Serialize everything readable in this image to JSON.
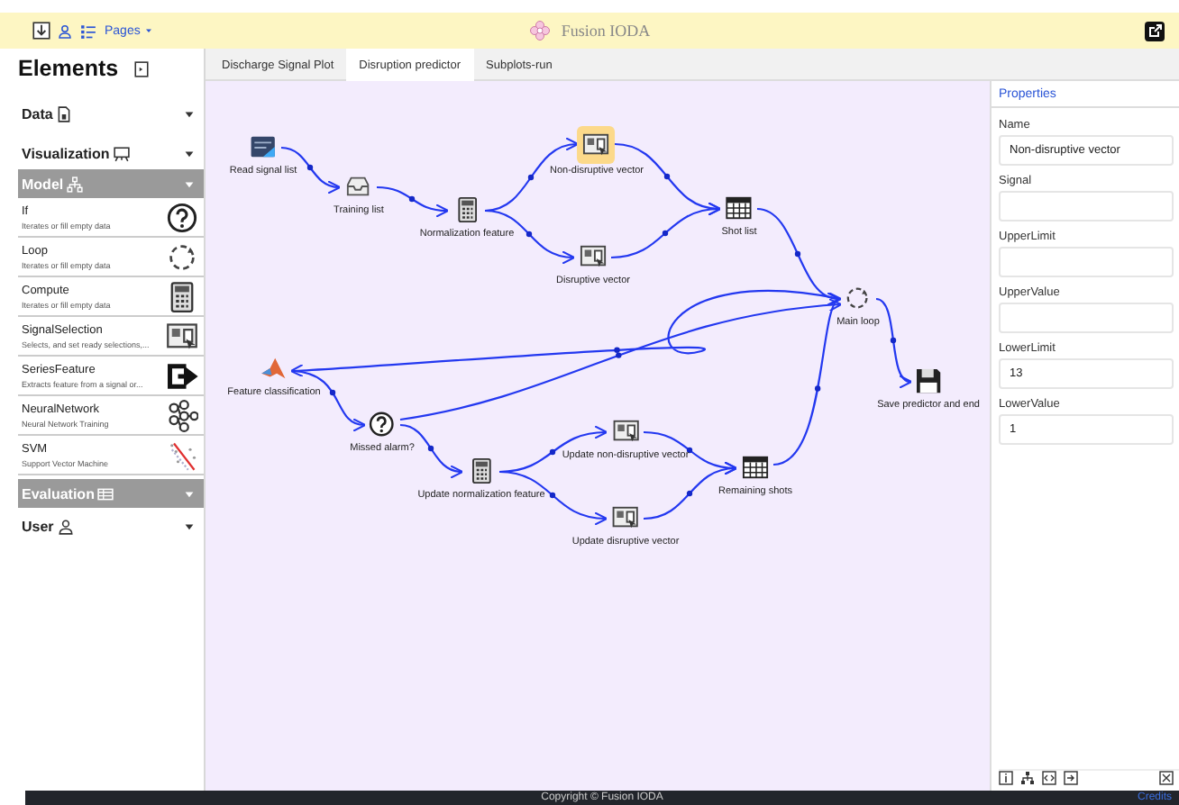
{
  "header": {
    "menu": "Pages",
    "title": "Fusion IODA"
  },
  "sidebar": {
    "title": "Elements",
    "sections": [
      {
        "label": "Data",
        "active": false
      },
      {
        "label": "Visualization",
        "active": false
      },
      {
        "label": "Model",
        "active": true,
        "items": [
          {
            "title": "If",
            "description": "Iterates or fill empty data"
          },
          {
            "title": "Loop",
            "description": "Iterates or fill empty data"
          },
          {
            "title": "Compute",
            "description": "Iterates or fill empty data"
          },
          {
            "title": "SignalSelection",
            "description": "Selects, and set ready selections,..."
          },
          {
            "title": "SeriesFeature",
            "description": "Extracts feature from a signal or..."
          },
          {
            "title": "NeuralNetwork",
            "description": "Neural Network Training"
          },
          {
            "title": "SVM",
            "description": "Support Vector Machine"
          }
        ]
      },
      {
        "label": "Evaluation",
        "active": true
      },
      {
        "label": "User",
        "active": false
      }
    ]
  },
  "tabs": [
    {
      "label": "Discharge Signal Plot",
      "selected": false
    },
    {
      "label": "Disruption predictor",
      "selected": true
    },
    {
      "label": "Subplots-run",
      "selected": false
    }
  ],
  "diagram": {
    "nodes": [
      {
        "label": "Read signal list",
        "selected": false
      },
      {
        "label": "Training list",
        "selected": false
      },
      {
        "label": "Normalization feature",
        "selected": false
      },
      {
        "label": "Non-disruptive vector",
        "selected": true
      },
      {
        "label": "Disruptive vector",
        "selected": false
      },
      {
        "label": "Shot list",
        "selected": false
      },
      {
        "label": "Main loop",
        "selected": false
      },
      {
        "label": "Save predictor and end",
        "selected": false
      },
      {
        "label": "Feature classification",
        "selected": false
      },
      {
        "label": "Missed alarm?",
        "selected": false
      },
      {
        "label": "Update normalization feature",
        "selected": false
      },
      {
        "label": "Update non-disruptive vector",
        "selected": false
      },
      {
        "label": "Update disruptive vector",
        "selected": false
      },
      {
        "label": "Remaining shots",
        "selected": false
      }
    ]
  },
  "properties": {
    "title": "Properties",
    "fields": [
      {
        "label": "Name",
        "value": "Non-disruptive vector"
      },
      {
        "label": "Signal"
      },
      {
        "label": "UpperLimit"
      },
      {
        "label": "UpperValue"
      },
      {
        "label": "LowerLimit",
        "value": "13"
      },
      {
        "label": "LowerValue",
        "value": "1"
      }
    ]
  },
  "footer": {
    "copyright": "Copyright © Fusion IODA",
    "link": "Credits"
  }
}
